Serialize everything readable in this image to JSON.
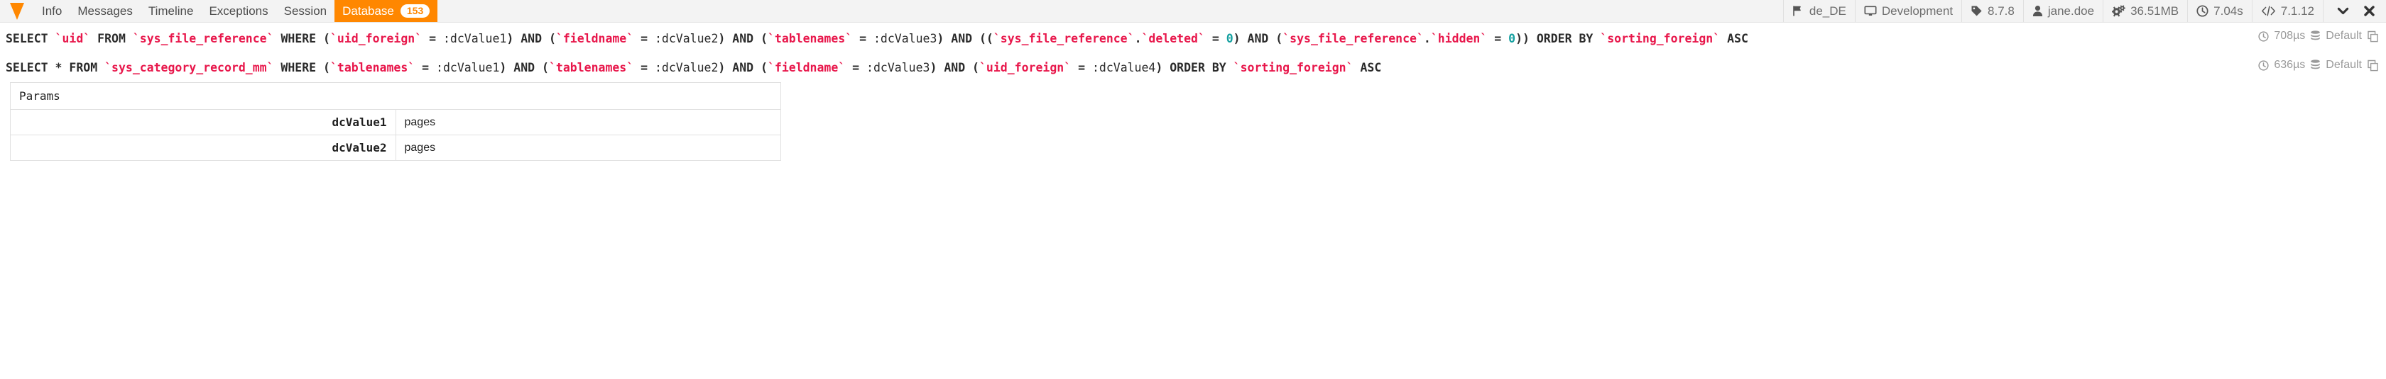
{
  "toolbar": {
    "logo_name": "typo3-logo",
    "accent_color": "#ff8700",
    "nav": [
      {
        "label": "Info",
        "active": false
      },
      {
        "label": "Messages",
        "active": false
      },
      {
        "label": "Timeline",
        "active": false
      },
      {
        "label": "Exceptions",
        "active": false
      },
      {
        "label": "Session",
        "active": false
      },
      {
        "label": "Database",
        "active": true,
        "badge": "153"
      }
    ],
    "info": [
      {
        "icon": "flag-icon",
        "label": "de_DE"
      },
      {
        "icon": "monitor-icon",
        "label": "Development"
      },
      {
        "icon": "tag-icon",
        "label": "8.7.8"
      },
      {
        "icon": "user-icon",
        "label": "jane.doe"
      },
      {
        "icon": "gears-icon",
        "label": "36.51MB"
      },
      {
        "icon": "clock-icon",
        "label": "7.04s"
      },
      {
        "icon": "code-icon",
        "label": "7.1.12"
      }
    ],
    "window_controls": [
      {
        "icon": "chevron-down-icon",
        "name": "collapse-button"
      },
      {
        "icon": "close-icon",
        "name": "close-button"
      }
    ]
  },
  "queries": [
    {
      "duration": "708µs",
      "connection": "Default",
      "connection_icon": "database-icon",
      "duration_icon": "clock-icon",
      "copy_icon": "copy-icon",
      "sql_tokens": [
        {
          "t": "SELECT ",
          "c": "kw"
        },
        {
          "t": "`uid`",
          "c": "id"
        },
        {
          "t": " FROM ",
          "c": "kw"
        },
        {
          "t": "`sys_file_reference`",
          "c": "id"
        },
        {
          "t": " WHERE (",
          "c": "kw"
        },
        {
          "t": "`uid_foreign`",
          "c": "id"
        },
        {
          "t": " = ",
          "c": "kw"
        },
        {
          "t": ":dcValue1",
          "c": "pl"
        },
        {
          "t": ") AND (",
          "c": "kw"
        },
        {
          "t": "`fieldname`",
          "c": "id"
        },
        {
          "t": " = ",
          "c": "kw"
        },
        {
          "t": ":dcValue2",
          "c": "pl"
        },
        {
          "t": ") AND (",
          "c": "kw"
        },
        {
          "t": "`tablenames`",
          "c": "id"
        },
        {
          "t": " = ",
          "c": "kw"
        },
        {
          "t": ":dcValue3",
          "c": "pl"
        },
        {
          "t": ") AND ((",
          "c": "kw"
        },
        {
          "t": "`sys_file_reference`",
          "c": "id"
        },
        {
          "t": ".",
          "c": "kw"
        },
        {
          "t": "`deleted`",
          "c": "id"
        },
        {
          "t": " = ",
          "c": "kw"
        },
        {
          "t": "0",
          "c": "num"
        },
        {
          "t": ") AND (",
          "c": "kw"
        },
        {
          "t": "`sys_file_reference`",
          "c": "id"
        },
        {
          "t": ".",
          "c": "kw"
        },
        {
          "t": "`hidden`",
          "c": "id"
        },
        {
          "t": " = ",
          "c": "kw"
        },
        {
          "t": "0",
          "c": "num"
        },
        {
          "t": ")) ORDER BY ",
          "c": "kw"
        },
        {
          "t": "`sorting_foreign`",
          "c": "id"
        },
        {
          "t": " ASC",
          "c": "kw"
        }
      ],
      "params": null
    },
    {
      "duration": "636µs",
      "connection": "Default",
      "connection_icon": "database-icon",
      "duration_icon": "clock-icon",
      "copy_icon": "copy-icon",
      "sql_tokens": [
        {
          "t": "SELECT * FROM ",
          "c": "kw"
        },
        {
          "t": "`sys_category_record_mm`",
          "c": "id"
        },
        {
          "t": " WHERE (",
          "c": "kw"
        },
        {
          "t": "`tablenames`",
          "c": "id"
        },
        {
          "t": " = ",
          "c": "kw"
        },
        {
          "t": ":dcValue1",
          "c": "pl"
        },
        {
          "t": ") AND (",
          "c": "kw"
        },
        {
          "t": "`tablenames`",
          "c": "id"
        },
        {
          "t": " = ",
          "c": "kw"
        },
        {
          "t": ":dcValue2",
          "c": "pl"
        },
        {
          "t": ") AND (",
          "c": "kw"
        },
        {
          "t": "`fieldname`",
          "c": "id"
        },
        {
          "t": " = ",
          "c": "kw"
        },
        {
          "t": ":dcValue3",
          "c": "pl"
        },
        {
          "t": ") AND (",
          "c": "kw"
        },
        {
          "t": "`uid_foreign`",
          "c": "id"
        },
        {
          "t": " = ",
          "c": "kw"
        },
        {
          "t": ":dcValue4",
          "c": "pl"
        },
        {
          "t": ") ORDER BY ",
          "c": "kw"
        },
        {
          "t": "`sorting_foreign`",
          "c": "id"
        },
        {
          "t": " ASC",
          "c": "kw"
        }
      ],
      "params": {
        "header": "Params",
        "rows": [
          {
            "name": "dcValue1",
            "value": "pages"
          },
          {
            "name": "dcValue2",
            "value": "pages"
          }
        ]
      }
    }
  ]
}
